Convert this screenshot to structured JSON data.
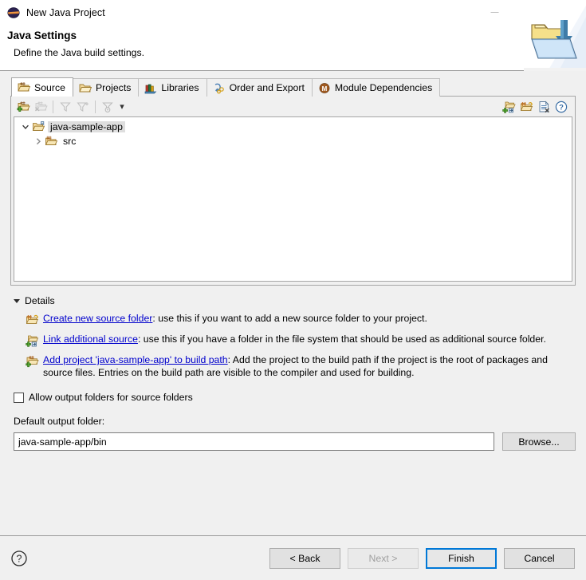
{
  "window": {
    "title": "New Java Project",
    "app_icon": "eclipse-icon",
    "controls": {
      "minimize": "—",
      "maximize": "□",
      "close": "✕"
    }
  },
  "header": {
    "title": "Java Settings",
    "subtitle": "Define the Java build settings.",
    "banner_icon": "folder-import-banner-icon"
  },
  "tabs": [
    {
      "label": "Source",
      "icon": "source-folder-icon",
      "active": true
    },
    {
      "label": "Projects",
      "icon": "projects-folder-icon",
      "active": false
    },
    {
      "label": "Libraries",
      "icon": "libraries-books-icon",
      "active": false
    },
    {
      "label": "Order and Export",
      "icon": "order-export-icon",
      "active": false
    },
    {
      "label": "Module Dependencies",
      "icon": "module-dependencies-icon",
      "active": false
    }
  ],
  "toolbar": {
    "left": [
      {
        "name": "add-folder-icon",
        "enabled": true
      },
      {
        "name": "remove-folder-icon",
        "enabled": false
      },
      {
        "name": "collapse-filter-icon",
        "enabled": false
      },
      {
        "name": "expand-filter-icon",
        "enabled": false
      },
      {
        "name": "filter-settings-icon",
        "enabled": false
      }
    ],
    "dropdown_caret": "▾",
    "right": [
      {
        "name": "create-source-folder-icon"
      },
      {
        "name": "link-source-folder-icon"
      },
      {
        "name": "clear-entries-icon"
      },
      {
        "name": "help-icon"
      }
    ]
  },
  "tree": {
    "root": {
      "label": "java-sample-app",
      "icon": "project-source-folder-icon",
      "expanded": true,
      "selected": true,
      "arrow": "⌄"
    },
    "children": [
      {
        "label": "src",
        "icon": "source-package-folder-icon",
        "expanded": false,
        "arrow": "›"
      }
    ]
  },
  "details": {
    "header": "Details",
    "expanded": true,
    "items": [
      {
        "icon": "create-new-source-folder-icon",
        "link": "Create new source folder",
        "text": ": use this if you want to add a new source folder to your project."
      },
      {
        "icon": "link-additional-source-icon",
        "link": "Link additional source",
        "text": ": use this if you have a folder in the file system that should be used as additional source folder."
      },
      {
        "icon": "add-project-to-build-path-icon",
        "link": "Add project 'java-sample-app' to build path",
        "text": ": Add the project to the build path if the project is the root of packages and source files. Entries on the build path are visible to the compiler and used for building."
      }
    ]
  },
  "options": {
    "allow_output_folders": {
      "label": "Allow output folders for source folders",
      "checked": false
    },
    "default_output_folder": {
      "label": "Default output folder:",
      "value": "java-sample-app/bin",
      "placeholder": "",
      "browse_label": "Browse..."
    }
  },
  "footer": {
    "help_icon": "help-question-icon",
    "buttons": [
      {
        "label": "< Back",
        "state": "enabled"
      },
      {
        "label": "Next >",
        "state": "disabled"
      },
      {
        "label": "Finish",
        "state": "default"
      },
      {
        "label": "Cancel",
        "state": "enabled"
      }
    ]
  },
  "colors": {
    "link": "#0000cc",
    "default_button_border": "#0078d7",
    "body_bg": "#f0f0f0",
    "panel_bg": "#ffffff",
    "selection": "#dedede"
  }
}
